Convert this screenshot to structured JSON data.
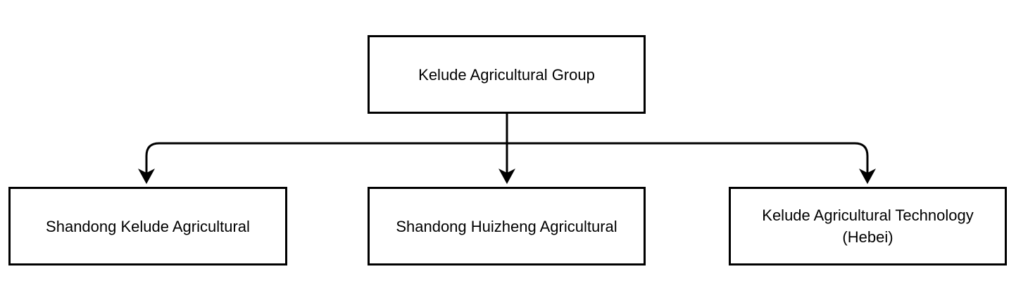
{
  "diagram": {
    "root": {
      "label": "Kelude Agricultural Group"
    },
    "children": [
      {
        "label": "Shandong Kelude Agricultural"
      },
      {
        "label": "Shandong Huizheng Agricultural"
      },
      {
        "label": "Kelude Agricultural Technology (Hebei)"
      }
    ],
    "colors": {
      "stroke": "#000000",
      "background": "#ffffff",
      "text": "#000000"
    }
  }
}
